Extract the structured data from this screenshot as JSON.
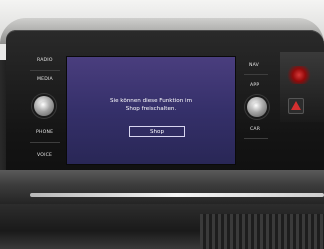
{
  "left_controls": {
    "radio": "RADIO",
    "media": "MEDIA",
    "phone": "PHONE",
    "voice": "VOICE"
  },
  "right_controls": {
    "nav": "NAV",
    "app": "APP",
    "car": "CAR"
  },
  "screen": {
    "message_line1": "Sie können diese Funktion im",
    "message_line2": "Shop freischalten.",
    "shop_button": "Shop"
  },
  "colors": {
    "screen_top": "#4a3e7e",
    "screen_bottom": "#292756",
    "hazard_red": "#d43030"
  },
  "icons": [
    "volume-knob-icon",
    "tune-knob-icon",
    "hazard-triangle-icon"
  ]
}
